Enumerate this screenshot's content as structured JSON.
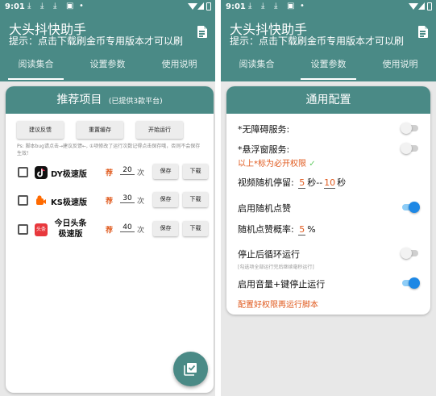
{
  "status_bar": {
    "time": "9:01"
  },
  "app": {
    "title": "大头抖快助手",
    "subtitle": "提示：点击下载刷金币专用版本才可以刷",
    "header_icon": "document-icon",
    "brand_color": "#4a8a86"
  },
  "tabs": [
    "阅读集合",
    "设置参数",
    "使用说明"
  ],
  "left": {
    "active_tab": 0,
    "card_title": "推荐项目",
    "card_subtitle": "(已提供3款平台)",
    "buttons": [
      "建议反馈",
      "重置缓存",
      "开始运行"
    ],
    "hint": "Ps: 脚本bug请点击→建议反馈←, ①项修改了运行次数记得点击保存哦，否则不会保存生效！",
    "projects": [
      {
        "name": "DY极速版",
        "icon": "douyin-logo-icon",
        "tag": "荐",
        "count": "20",
        "unit": "次",
        "save": "保存",
        "download": "下载"
      },
      {
        "name": "KS极速版",
        "icon": "kuaishou-logo-icon",
        "tag": "荐",
        "count": "30",
        "unit": "次",
        "save": "保存",
        "download": "下载"
      },
      {
        "name": "今日头条极速版",
        "name_line1": "今日头条",
        "name_line2": "极速版",
        "icon": "toutiao-logo-icon",
        "icon_text": "头条",
        "tag": "荐",
        "count": "40",
        "unit": "次",
        "save": "保存",
        "download": "下载"
      }
    ],
    "fab_icon": "check-box-icon"
  },
  "right": {
    "active_tab": 1,
    "card_title": "通用配置",
    "settings": {
      "accessibility": {
        "label": "*无障碍服务:",
        "on": false
      },
      "overlay": {
        "label": "*悬浮窗服务:",
        "on": false
      },
      "required_note": "以上*标为必开权限",
      "stay": {
        "label": "视频随机停留:",
        "min": "5",
        "mid": "秒--",
        "max": "10",
        "unit": "秒"
      },
      "random_like": {
        "label": "启用随机点赞",
        "on": true
      },
      "like_rate": {
        "label": "随机点赞概率:",
        "value": "5",
        "unit": "%"
      },
      "stop_loop": {
        "label": "停止后循环运行",
        "on": false,
        "note": "[勾选项全部运行完后继续毫秒运行]"
      },
      "volume_stop": {
        "label": "启用音量+键停止运行",
        "on": true
      },
      "footer_note": "配置好权限再运行脚本"
    }
  }
}
